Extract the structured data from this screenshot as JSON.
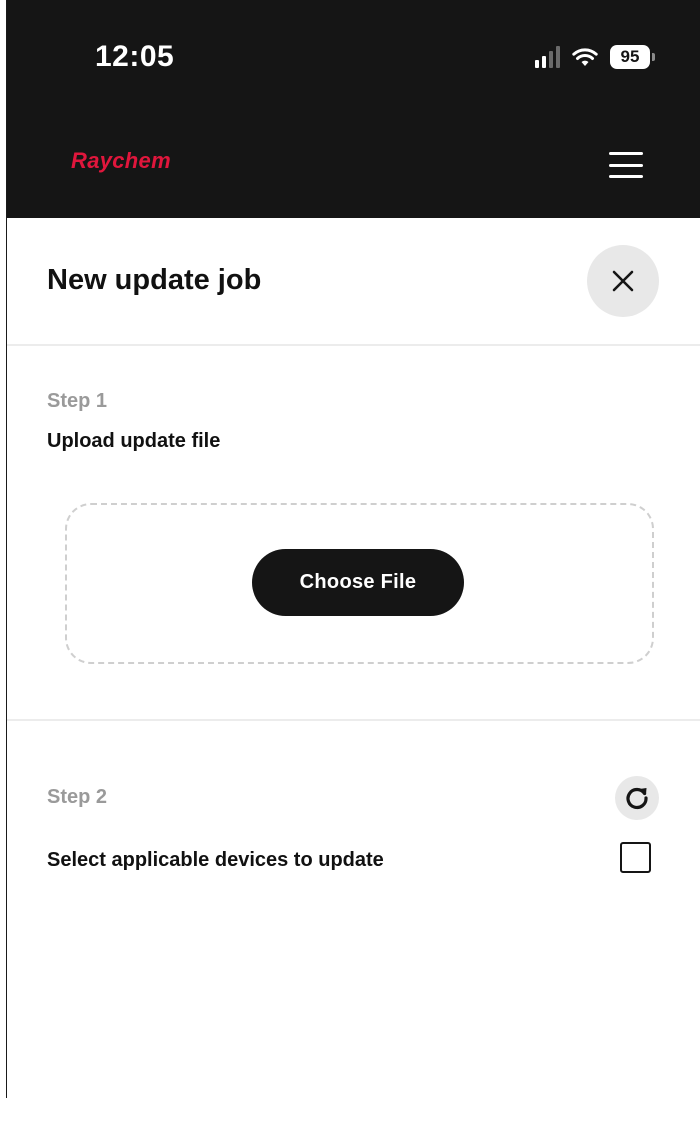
{
  "status_bar": {
    "time": "12:05",
    "battery": "95"
  },
  "app_header": {
    "logo": "Raychem",
    "logo_color": "#e0163c",
    "menu_icon": "hamburger-icon"
  },
  "page": {
    "title": "New update job",
    "close_icon": "close-icon"
  },
  "step1": {
    "label": "Step 1",
    "description": "Upload update file",
    "button_label": "Choose File"
  },
  "step2": {
    "label": "Step 2",
    "description": "Select applicable devices to update",
    "refresh_icon": "refresh-icon",
    "select_all_checked": false
  }
}
